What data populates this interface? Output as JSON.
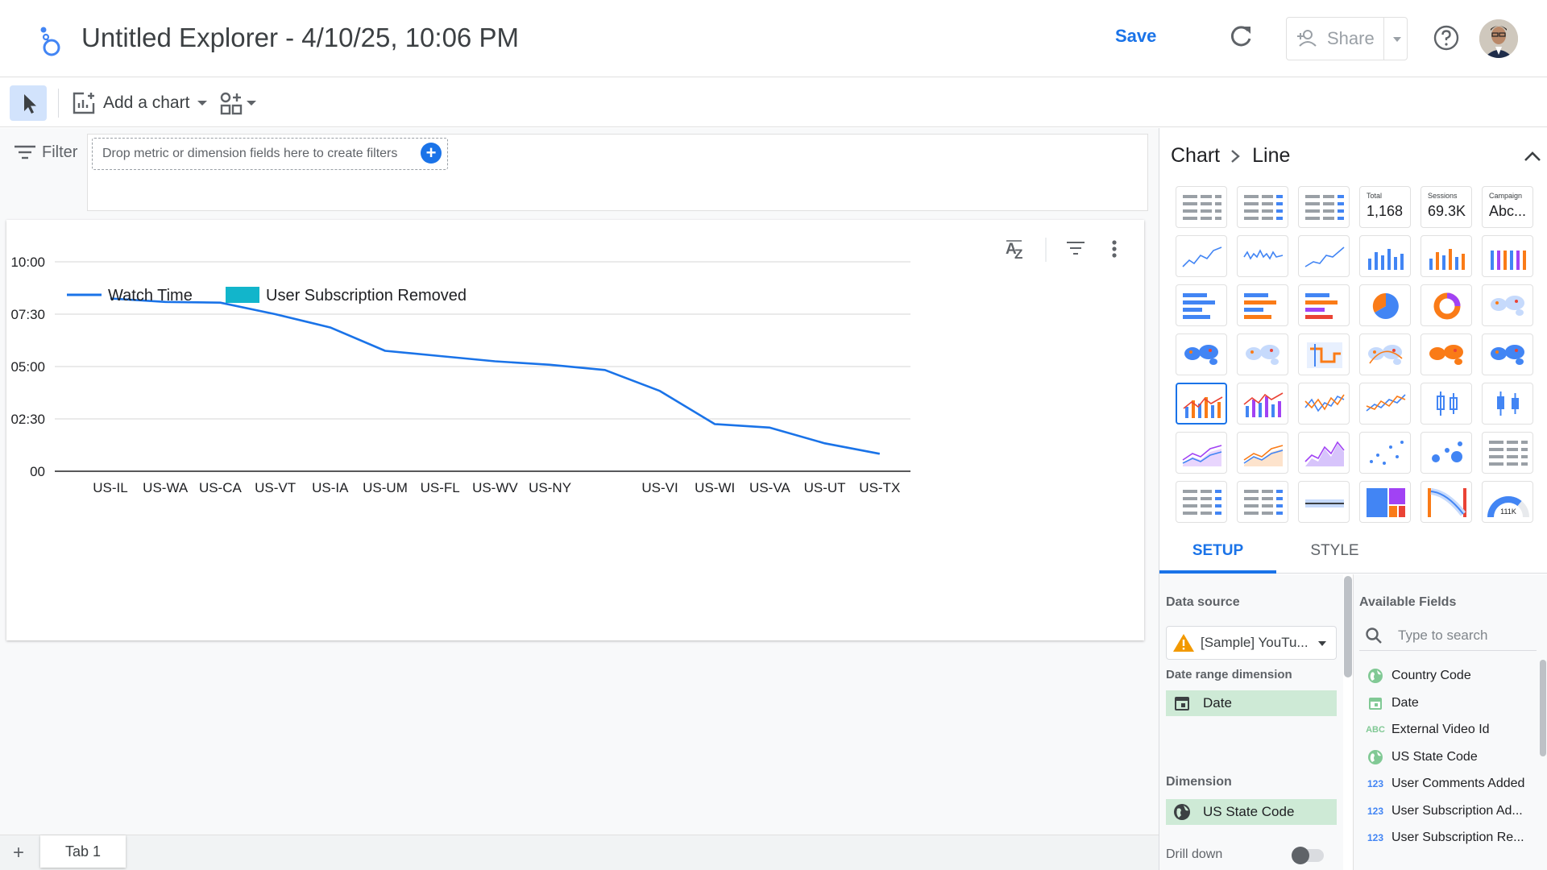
{
  "header": {
    "title": "Untitled Explorer - 4/10/25, 10:06 PM",
    "save_label": "Save",
    "share_label": "Share"
  },
  "toolbar": {
    "add_chart_label": "Add a chart"
  },
  "filter": {
    "label": "Filter",
    "drop_placeholder": "Drop metric or dimension fields here to create filters"
  },
  "chart_data": {
    "type": "line",
    "categories": [
      "US-IL",
      "US-WA",
      "US-CA",
      "US-VT",
      "US-IA",
      "US-UM",
      "US-FL",
      "US-WV",
      "US-NY",
      "",
      "US-VI",
      "US-WI",
      "US-VA",
      "US-UT",
      "US-TX"
    ],
    "series": [
      {
        "name": "Watch Time",
        "values": [
          "08:15",
          "08:05",
          "08:03",
          "07:30",
          "06:52",
          "05:45",
          "05:30",
          "05:15",
          "05:05",
          "04:50",
          "03:50",
          "02:15",
          "02:05",
          "01:20",
          "00:50"
        ],
        "color": "#1a73e8"
      },
      {
        "name": "User Subscription Removed",
        "values": [
          0,
          0,
          0,
          0,
          0,
          0,
          0,
          0,
          0,
          0.05,
          0,
          0,
          0,
          0,
          0
        ],
        "color": "#12b5cb"
      }
    ],
    "y_ticks": [
      "10:00",
      "07:30",
      "05:00",
      "02:30",
      "00"
    ],
    "ylim": [
      "00:00",
      "10:00"
    ],
    "grid": true,
    "legend_position": "top-left"
  },
  "panel": {
    "crumb_root": "Chart",
    "crumb_leaf": "Line",
    "scorecards": [
      {
        "label": "Total",
        "value": "1,168"
      },
      {
        "label": "Sessions",
        "value": "69.3K"
      },
      {
        "label": "Campaign",
        "value": "Abc..."
      }
    ],
    "gauge_label": "111K",
    "tab_setup": "SETUP",
    "tab_style": "STYLE",
    "data_source_label": "Data source",
    "data_source_value": "[Sample] YouTu...",
    "date_range_label": "Date range dimension",
    "date_range_value": "Date",
    "dimension_label": "Dimension",
    "dimension_value": "US State Code",
    "drill_down_label": "Drill down",
    "available_fields_label": "Available Fields",
    "search_placeholder": "Type to search",
    "fields": [
      {
        "type": "geo",
        "name": "Country Code"
      },
      {
        "type": "date",
        "name": "Date"
      },
      {
        "type": "text",
        "name": "External Video Id"
      },
      {
        "type": "geo",
        "name": "US State Code"
      },
      {
        "type": "number",
        "name": "User Comments Added"
      },
      {
        "type": "number",
        "name": "User Subscription Ad..."
      },
      {
        "type": "number",
        "name": "User Subscription Re..."
      }
    ]
  },
  "tabs": {
    "tab1_label": "Tab 1"
  },
  "colors": {
    "accent": "#1a73e8",
    "line": "#1a73e8",
    "bar": "#12b5cb",
    "chip": "#ceead6"
  }
}
